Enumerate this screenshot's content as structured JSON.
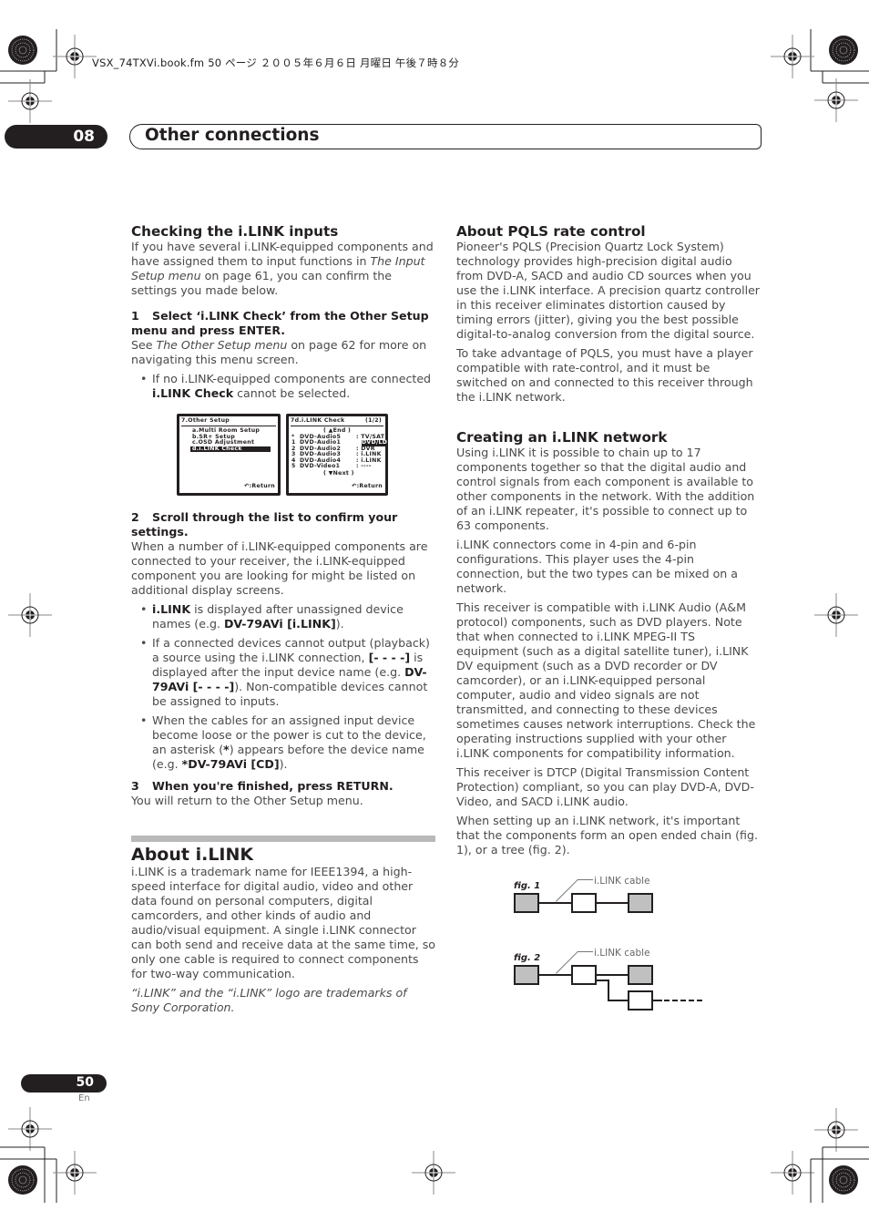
{
  "print_meta": "VSX_74TXVi.book.fm  50 ページ  ２００５年６月６日  月曜日  午後７時８分",
  "header": {
    "chapter_number": "08",
    "chapter_title": "Other connections"
  },
  "left": {
    "checking": {
      "title": "Checking the i.LINK inputs",
      "intro_a": "If you have several i.LINK-equipped components and have assigned them to input functions in ",
      "intro_em": "The Input Setup menu",
      "intro_b": " on page 61, you can confirm the settings you made below.",
      "step1_num": "1",
      "step1_text": "Select ‘i.LINK Check’ from the Other Setup menu and press ENTER.",
      "step1_see_a": "See ",
      "step1_see_em": "The Other Setup menu",
      "step1_see_b": " on page 62 for more on navigating this menu screen.",
      "step1_bullet_a": "If no i.LINK-equipped components are connected ",
      "step1_bullet_b": "i.LINK Check",
      "step1_bullet_c": " cannot be selected.",
      "osd1": {
        "header": "7.Other  Setup",
        "items": [
          "a.Multi  Room  Setup",
          "b.SR+  Setup",
          "c.OSD  Adjustment",
          "d.i.LINK  Check"
        ],
        "selected_index": 3,
        "return_label": "↶:Return"
      },
      "osd2": {
        "header": "7d.i.LINK  Check",
        "page": "(1/2)",
        "end_label": "( ▲End  )",
        "rows": [
          {
            "mark": "*",
            "name": "DVD-Audio5",
            "value": ": TV/SAT",
            "highlight": false
          },
          {
            "mark": "1",
            "name": "DVD-Audio1",
            "value": "DVD/LD",
            "highlight": true
          },
          {
            "mark": "2",
            "name": "DVD-Audio2",
            "value": ":   DVR",
            "highlight": false
          },
          {
            "mark": "3",
            "name": "DVD-Audio3",
            "value": ": i.LINK",
            "highlight": false
          },
          {
            "mark": "4",
            "name": "DVD-Audio4",
            "value": ": i.LINK",
            "highlight": false
          },
          {
            "mark": "5",
            "name": "DVD-Video1",
            "value": ":   ----",
            "highlight": false
          }
        ],
        "next_label": "( ▼Next  )",
        "return_label": "↶:Return"
      },
      "step2_num": "2",
      "step2_text": "Scroll through the list to confirm your settings.",
      "step2_body": "When a number of i.LINK-equipped components are connected to your receiver, the i.LINK-equipped component you are looking for might be listed on additional display screens.",
      "b1_a": "i.LINK",
      "b1_b": " is displayed after unassigned device names (e.g. ",
      "b1_c": "DV-79AVi [i.LINK]",
      "b1_d": ").",
      "b2_a": "If a connected devices cannot output (playback) a source using the i.LINK connection, ",
      "b2_b": "[- - - -]",
      "b2_c": " is displayed after the input device name (e.g. ",
      "b2_d": "DV-79AVi [- - - -]",
      "b2_e": "). Non-compatible devices cannot be assigned to inputs.",
      "b3_a": "When the cables for an assigned input device become loose or the power is cut to the device, an asterisk (",
      "b3_b": "*",
      "b3_c": ") appears before the device name (e.g. ",
      "b3_d": "*DV-79AVi [CD]",
      "b3_e": ").",
      "step3_num": "3",
      "step3_text": "When you're finished, press RETURN.",
      "step3_body": "You will return to the Other Setup menu."
    },
    "about": {
      "title": "About i.LINK",
      "body": "i.LINK is a trademark name for IEEE1394, a high-speed interface for digital audio, video and other data found on personal computers, digital camcorders, and other kinds of audio and audio/visual equipment. A single i.LINK connector can both send and receive data at the same time, so only one cable is required to connect components for two-way communication.",
      "trademark": "“i.LINK” and the “i.LINK” logo are trademarks of Sony Corporation."
    }
  },
  "right": {
    "pqls": {
      "title": "About PQLS rate control",
      "p1": "Pioneer's PQLS (Precision Quartz Lock System) technology provides high-precision digital audio from DVD-A, SACD and audio CD sources when you use the i.LINK interface. A precision quartz controller in this receiver eliminates distortion caused by timing errors (jitter), giving you the best possible digital-to-analog conversion from the digital source.",
      "p2": "To take advantage of PQLS, you must have a player compatible with rate-control, and it must be switched on and connected to this receiver through the i.LINK network."
    },
    "network": {
      "title": "Creating an i.LINK network",
      "p1": "Using i.LINK it is possible to chain up to 17 components together so that the digital audio and control signals from each component is available to other components in the network. With the addition of an i.LINK repeater, it's possible to connect up to 63 components.",
      "p2": "i.LINK connectors come in 4-pin and 6-pin configurations. This player uses the 4-pin connection, but the two types can be mixed on a network.",
      "p3": "This receiver is compatible with i.LINK Audio (A&M protocol) components, such as DVD players. Note that when connected to i.LINK MPEG-II TS equipment (such as a digital satellite tuner), i.LINK DV equipment (such as a DVD recorder or DV camcorder), or an i.LINK-equipped personal computer, audio and video signals are not transmitted, and connecting to these devices sometimes causes network interruptions. Check the operating instructions supplied with your other i.LINK components for compatibility information.",
      "p4": "This receiver is DTCP (Digital Transmission Content Protection) compliant, so you can play DVD-A, DVD-Video, and SACD i.LINK audio.",
      "p5": "When setting up an i.LINK network, it's important that the components form an open ended chain (fig. 1), or a tree (fig. 2)."
    },
    "figures": {
      "fig1_label": "fig. 1",
      "fig2_label": "fig. 2",
      "cable_label": "i.LINK cable"
    }
  },
  "footer": {
    "page_number": "50",
    "language": "En"
  }
}
